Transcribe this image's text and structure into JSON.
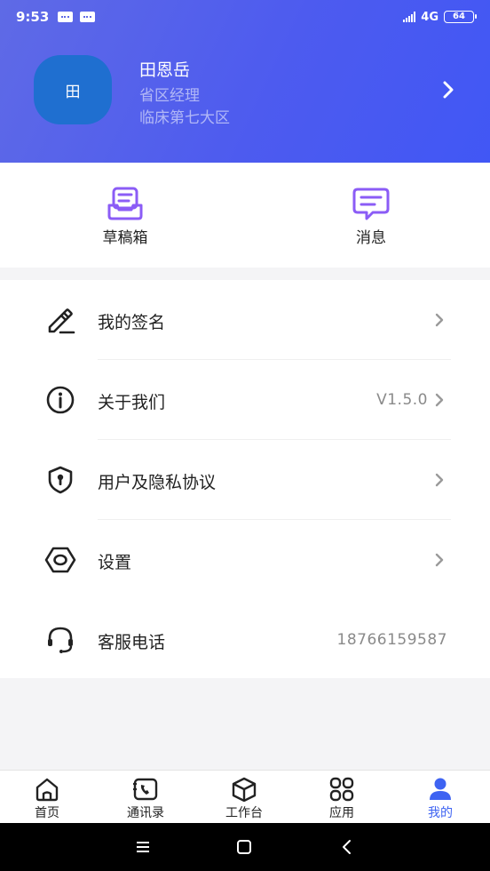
{
  "status": {
    "time": "9:53",
    "network": "4G",
    "battery": "64"
  },
  "profile": {
    "avatar_text": "田",
    "name": "田恩岳",
    "title": "省区经理",
    "region": "临床第七大区"
  },
  "quick_actions": [
    {
      "label": "草稿箱",
      "icon": "drafts-icon"
    },
    {
      "label": "消息",
      "icon": "message-icon"
    }
  ],
  "menu": [
    {
      "label": "我的签名",
      "icon": "signature-pen-icon",
      "value": ""
    },
    {
      "label": "关于我们",
      "icon": "info-icon",
      "value": "V1.5.0"
    },
    {
      "label": "用户及隐私协议",
      "icon": "privacy-shield-icon",
      "value": ""
    },
    {
      "label": "设置",
      "icon": "settings-hexagon-icon",
      "value": ""
    },
    {
      "label": "客服电话",
      "icon": "headset-icon",
      "value": "18766159587"
    }
  ],
  "tabs": [
    {
      "label": "首页",
      "icon": "home-icon",
      "active": false
    },
    {
      "label": "通讯录",
      "icon": "contacts-icon",
      "active": false
    },
    {
      "label": "工作台",
      "icon": "workbench-icon",
      "active": false
    },
    {
      "label": "应用",
      "icon": "apps-icon",
      "active": false
    },
    {
      "label": "我的",
      "icon": "profile-icon",
      "active": true
    }
  ],
  "colors": {
    "header_gradient_start": "#5f6ae6",
    "header_gradient_end": "#4157f5",
    "accent": "#3e63f2",
    "quick_icon": "#8b5cf6",
    "avatar_bg": "#1f6fd0"
  }
}
